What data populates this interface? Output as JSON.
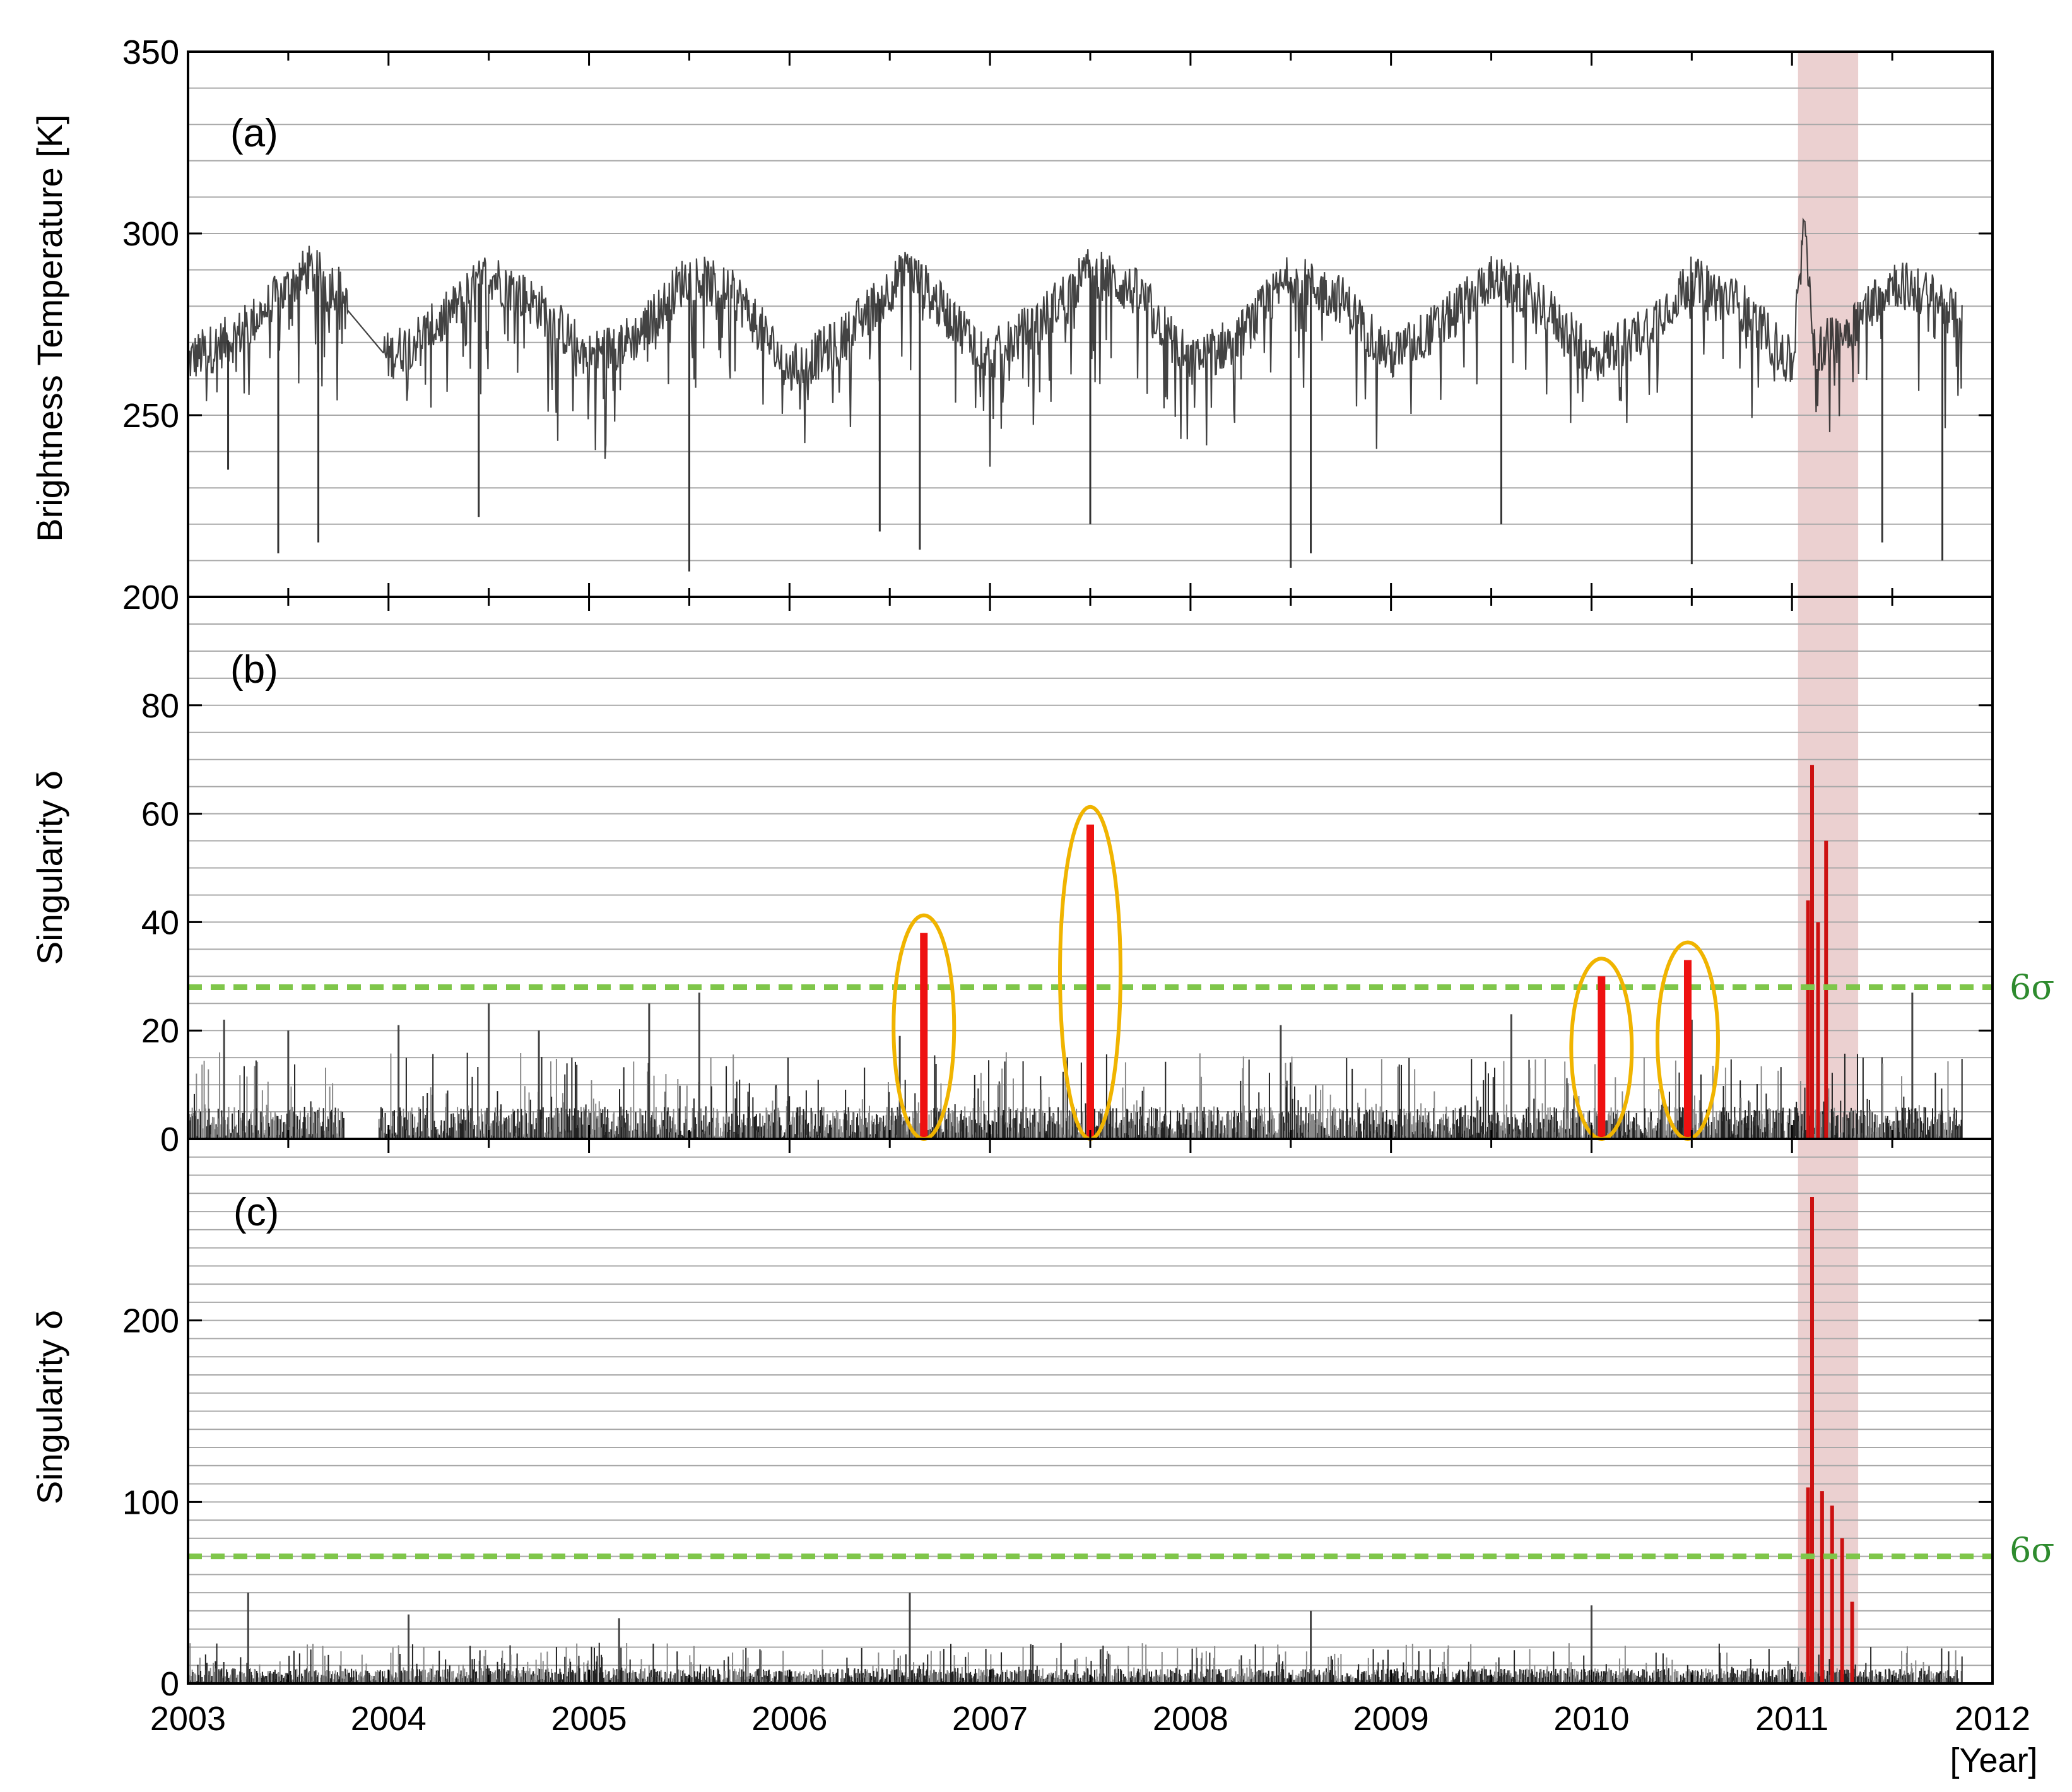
{
  "chart_data": [
    {
      "panel": "(a)",
      "type": "line",
      "ylabel": "Brightness Temperature [K]",
      "ylim": [
        200,
        350
      ],
      "yticks": [
        200,
        250,
        300,
        350
      ],
      "xlim": [
        2003,
        2012
      ],
      "grid": true,
      "highlight_span": [
        2011.03,
        2011.33
      ],
      "series": [
        {
          "style": "black-gray dense daily series",
          "x": [
            2003.0,
            2003.25,
            2003.5,
            2003.6,
            2003.75,
            2003.8,
            2004.0,
            2004.25,
            2004.5,
            2004.75,
            2005.0,
            2005.25,
            2005.5,
            2005.75,
            2006.0,
            2006.25,
            2006.5,
            2006.6,
            2006.75,
            2007.0,
            2007.25,
            2007.5,
            2007.75,
            2008.0,
            2008.25,
            2008.5,
            2008.75,
            2009.0,
            2009.25,
            2009.5,
            2009.75,
            2010.0,
            2010.25,
            2010.5,
            2010.75,
            2011.0,
            2011.07,
            2011.1,
            2011.25,
            2011.5,
            2011.75,
            2011.85
          ],
          "values": [
            265,
            272,
            285,
            290,
            285,
            278,
            266,
            275,
            289,
            280,
            266,
            272,
            289,
            282,
            262,
            270,
            285,
            290,
            280,
            266,
            276,
            290,
            283,
            264,
            272,
            288,
            282,
            266,
            275,
            288,
            281,
            265,
            273,
            287,
            280,
            264,
            305,
            268,
            272,
            287,
            281,
            275
          ],
          "min_spikes": [
            {
              "x": 2003.2,
              "y": 235
            },
            {
              "x": 2003.45,
              "y": 212
            },
            {
              "x": 2003.65,
              "y": 215
            },
            {
              "x": 2004.45,
              "y": 222
            },
            {
              "x": 2005.5,
              "y": 207
            },
            {
              "x": 2006.45,
              "y": 218
            },
            {
              "x": 2006.65,
              "y": 213
            },
            {
              "x": 2007.5,
              "y": 220
            },
            {
              "x": 2008.5,
              "y": 208
            },
            {
              "x": 2008.6,
              "y": 212
            },
            {
              "x": 2009.55,
              "y": 220
            },
            {
              "x": 2010.5,
              "y": 209
            },
            {
              "x": 2011.45,
              "y": 215
            },
            {
              "x": 2011.75,
              "y": 210
            }
          ]
        }
      ]
    },
    {
      "panel": "(b)",
      "type": "bar",
      "ylabel": "Singularity δ",
      "ylim": [
        0,
        100
      ],
      "yticks": [
        0,
        20,
        40,
        60,
        80
      ],
      "xlim": [
        2003,
        2012
      ],
      "grid": true,
      "threshold": {
        "label": "6σ",
        "value": 28
      },
      "highlight_span": [
        2011.03,
        2011.33
      ],
      "background_peaks": [
        {
          "x": 2003.18,
          "y": 22
        },
        {
          "x": 2003.5,
          "y": 20
        },
        {
          "x": 2004.05,
          "y": 21
        },
        {
          "x": 2004.5,
          "y": 25
        },
        {
          "x": 2004.75,
          "y": 20
        },
        {
          "x": 2005.3,
          "y": 25
        },
        {
          "x": 2005.55,
          "y": 27
        },
        {
          "x": 2006.55,
          "y": 19
        },
        {
          "x": 2008.45,
          "y": 21
        },
        {
          "x": 2009.6,
          "y": 23
        },
        {
          "x": 2010.5,
          "y": 22
        },
        {
          "x": 2011.6,
          "y": 27
        }
      ],
      "highlighted_events": [
        {
          "x": 2006.67,
          "y": 38
        },
        {
          "x": 2007.5,
          "y": 58
        },
        {
          "x": 2010.05,
          "y": 30
        },
        {
          "x": 2010.48,
          "y": 33
        }
      ],
      "earthquake_peaks": [
        {
          "x": 2011.08,
          "y": 44
        },
        {
          "x": 2011.1,
          "y": 69
        },
        {
          "x": 2011.13,
          "y": 40
        },
        {
          "x": 2011.17,
          "y": 55
        }
      ]
    },
    {
      "panel": "(c)",
      "type": "bar",
      "ylabel": "Singularity δ",
      "ylim": [
        0,
        300
      ],
      "yticks": [
        0,
        100,
        200
      ],
      "xlim": [
        2003,
        2012
      ],
      "xticks": [
        2003,
        2004,
        2005,
        2006,
        2007,
        2008,
        2009,
        2010,
        2011,
        2012
      ],
      "xunit": "[Year]",
      "grid": true,
      "threshold": {
        "label": "6σ",
        "value": 70
      },
      "highlight_span": [
        2011.03,
        2011.33
      ],
      "background_peaks": [
        {
          "x": 2003.3,
          "y": 50
        },
        {
          "x": 2004.1,
          "y": 38
        },
        {
          "x": 2005.15,
          "y": 36
        },
        {
          "x": 2006.6,
          "y": 50
        },
        {
          "x": 2008.6,
          "y": 40
        },
        {
          "x": 2010.0,
          "y": 43
        }
      ],
      "earthquake_peaks": [
        {
          "x": 2011.08,
          "y": 108
        },
        {
          "x": 2011.1,
          "y": 268
        },
        {
          "x": 2011.15,
          "y": 106
        },
        {
          "x": 2011.2,
          "y": 98
        },
        {
          "x": 2011.25,
          "y": 80
        },
        {
          "x": 2011.3,
          "y": 45
        }
      ]
    }
  ]
}
